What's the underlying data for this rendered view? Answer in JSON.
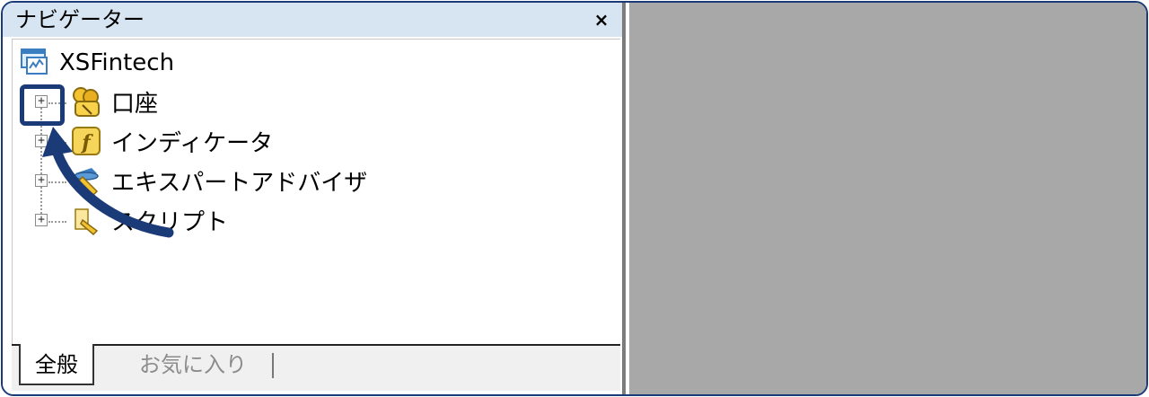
{
  "navigator": {
    "title": "ナビゲーター",
    "close_label": "×",
    "tree": {
      "root": {
        "label": "XSFintech",
        "icon": "terminal-icon"
      },
      "items": [
        {
          "label": "口座",
          "icon": "accounts-icon",
          "expander": "+"
        },
        {
          "label": "インディケータ",
          "icon": "indicator-icon",
          "expander": "+"
        },
        {
          "label": "エキスパートアドバイザ",
          "icon": "expert-advisor-icon",
          "expander": "+"
        },
        {
          "label": "スクリプト",
          "icon": "script-icon",
          "expander": "+"
        }
      ]
    },
    "tabs": [
      {
        "label": "全般",
        "active": true
      },
      {
        "label": "お気に入り",
        "active": false
      }
    ]
  },
  "annotation": {
    "highlight_color": "#1a3a78",
    "description": "expand button pointer"
  },
  "colors": {
    "titlebar_bg": "#d7e4f2",
    "right_pane_bg": "#a8a8a8",
    "frame_border": "#1a3a78"
  }
}
